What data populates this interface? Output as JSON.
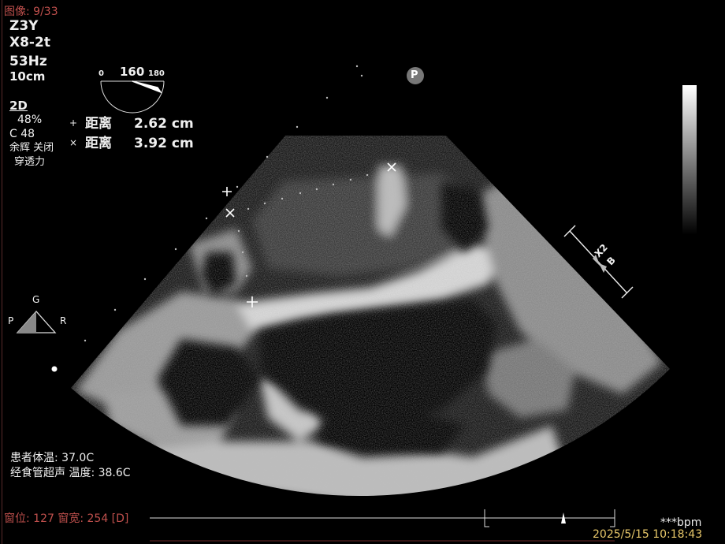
{
  "top_left": {
    "image_counter": "图像: 9/33",
    "patient_code": "Z3Y",
    "probe": "X8-2t",
    "frame_rate": "53Hz",
    "depth": "10cm"
  },
  "angle_indicator": {
    "min": "0",
    "value": "160",
    "max": "180"
  },
  "imaging_params": {
    "mode": "2D",
    "gain": "48%",
    "compression": "C 48",
    "persistence": "余辉 关闭",
    "penetration": "穿透力"
  },
  "measurements": [
    {
      "symbol": "+",
      "label": "距离",
      "value": "2.62 cm"
    },
    {
      "symbol": "×",
      "label": "距离",
      "value": "3.92 cm"
    }
  ],
  "orientation_marker": {
    "top": "G",
    "left": "P",
    "right": "R"
  },
  "pole_badge": "P",
  "scale_labels": {
    "label1": "X2",
    "label2": "B"
  },
  "temperature": {
    "patient": "患者体温: 37.0C",
    "probe": "经食管超声 温度: 38.6C"
  },
  "window_level": "窗位: 127 窗宽: 254 [D]",
  "heart_rate": "***bpm",
  "timestamp": "2025/5/15 10:18:43",
  "colors": {
    "red_text": "#c0504d",
    "timestamp": "#e8c86a",
    "white": "#f0f0f0"
  }
}
